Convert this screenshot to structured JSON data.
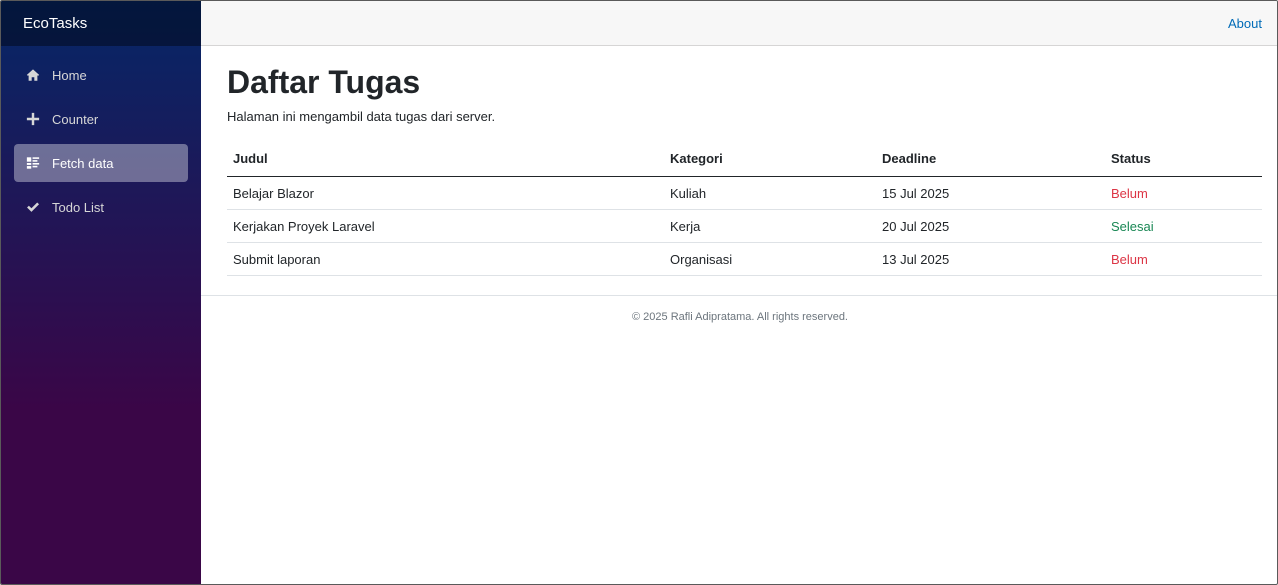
{
  "app": {
    "brand": "EcoTasks"
  },
  "sidebar": {
    "items": [
      {
        "label": "Home",
        "icon": "home-icon",
        "active": false
      },
      {
        "label": "Counter",
        "icon": "plus-icon",
        "active": false
      },
      {
        "label": "Fetch data",
        "icon": "list-icon",
        "active": true
      },
      {
        "label": "Todo List",
        "icon": "check-icon",
        "active": false
      }
    ]
  },
  "header": {
    "about_label": "About"
  },
  "page": {
    "title": "Daftar Tugas",
    "description": "Halaman ini mengambil data tugas dari server."
  },
  "table": {
    "columns": [
      "Judul",
      "Kategori",
      "Deadline",
      "Status"
    ],
    "rows": [
      {
        "judul": "Belajar Blazor",
        "kategori": "Kuliah",
        "deadline": "15 Jul 2025",
        "status": "Belum"
      },
      {
        "judul": "Kerjakan Proyek Laravel",
        "kategori": "Kerja",
        "deadline": "20 Jul 2025",
        "status": "Selesai"
      },
      {
        "judul": "Submit laporan",
        "kategori": "Organisasi",
        "deadline": "13 Jul 2025",
        "status": "Belum"
      }
    ]
  },
  "footer": {
    "text": "© 2025 Rafli Adipratama. All rights reserved."
  },
  "colors": {
    "status_belum": "#dc3545",
    "status_selesai": "#198754",
    "link": "#006bb7"
  }
}
